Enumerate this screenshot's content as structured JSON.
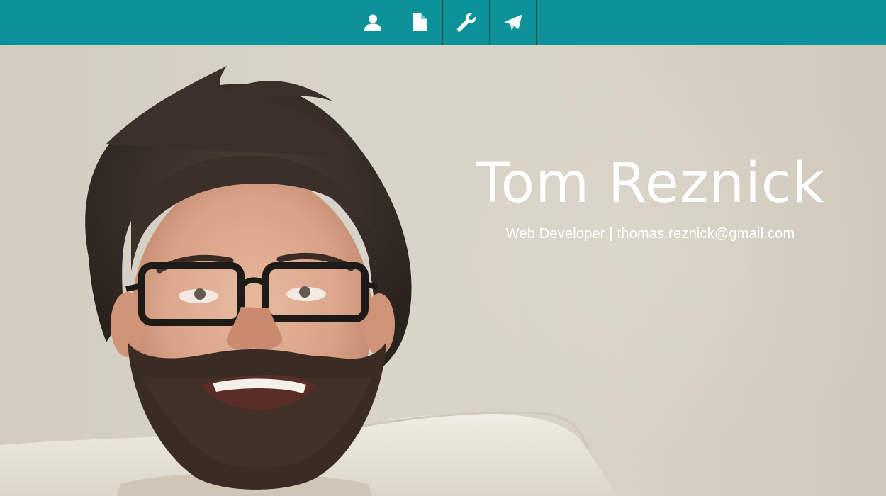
{
  "colors": {
    "nav_background": "#0e9299",
    "nav_divider": "#0a4f54",
    "nav_icon": "#ffffff",
    "hero_text": "#ffffff",
    "wall": "#d6d0c4"
  },
  "nav": {
    "items": [
      {
        "icon": "user-icon"
      },
      {
        "icon": "document-icon"
      },
      {
        "icon": "wrench-icon"
      },
      {
        "icon": "paper-plane-icon"
      }
    ]
  },
  "hero": {
    "name": "Tom Reznick",
    "role": "Web Developer",
    "separator": "|",
    "email": "thomas.reznick@gmail.com"
  }
}
